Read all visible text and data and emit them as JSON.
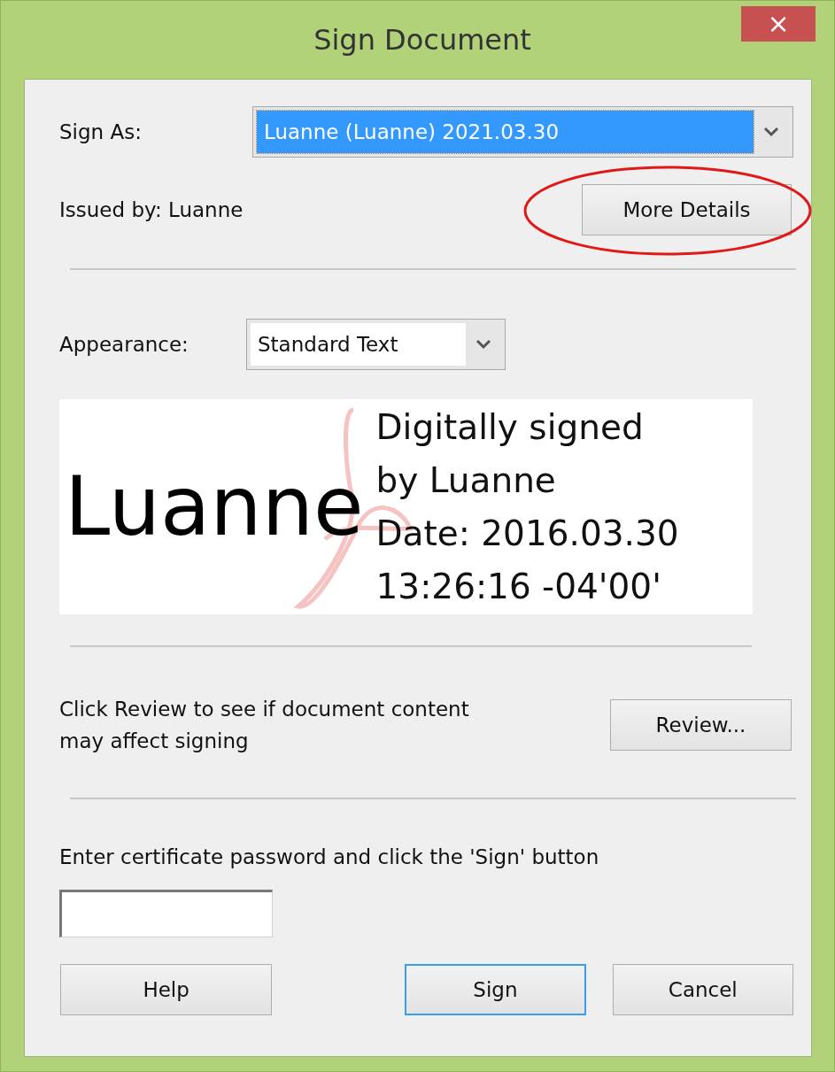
{
  "window": {
    "title": "Sign Document",
    "close": "×"
  },
  "sign_as": {
    "label": "Sign As:",
    "value": "Luanne (Luanne) 2021.03.30",
    "selected": true
  },
  "issued_by": "Issued by: Luanne",
  "more_details": {
    "label": "More Details",
    "circled": true
  },
  "appearance": {
    "label": "Appearance:",
    "value": "Standard Text"
  },
  "preview": {
    "name": "Luanne",
    "lines": [
      "Digitally signed",
      "by Luanne",
      "Date: 2016.03.30",
      "13:26:16 -04'00'"
    ]
  },
  "review": {
    "text": "Click Review to see if document content may affect signing",
    "button": "Review..."
  },
  "password": {
    "instruction": "Enter certificate password and click the 'Sign' button"
  },
  "buttons": [
    {
      "label": "Help",
      "focused": false
    },
    {
      "label": "Sign",
      "focused": true
    },
    {
      "label": "Cancel",
      "focused": false
    }
  ]
}
